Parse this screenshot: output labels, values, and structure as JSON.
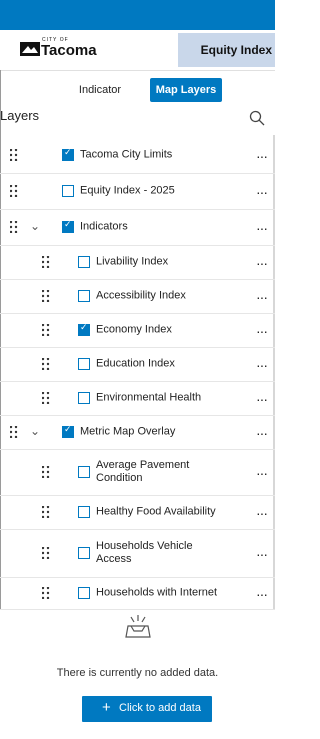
{
  "header": {
    "logo_small": "CITY OF",
    "logo_name": "Tacoma",
    "title": "Equity Index"
  },
  "tabs": [
    {
      "label": "Indicator",
      "active": false
    },
    {
      "label": "Map Layers",
      "active": true
    }
  ],
  "layers_title": "Layers",
  "layers": [
    {
      "label": "Tacoma City Limits",
      "checked": true,
      "level": 0,
      "expandable": false
    },
    {
      "label": "Equity Index - 2025",
      "checked": false,
      "level": 0,
      "expandable": false
    },
    {
      "label": "Indicators",
      "checked": true,
      "level": 0,
      "expandable": true,
      "expanded": true
    },
    {
      "label": "Livability Index",
      "checked": false,
      "level": 1
    },
    {
      "label": "Accessibility Index",
      "checked": false,
      "level": 1
    },
    {
      "label": "Economy Index",
      "checked": true,
      "level": 1
    },
    {
      "label": "Education Index",
      "checked": false,
      "level": 1
    },
    {
      "label": "Environmental Health",
      "checked": false,
      "level": 1
    },
    {
      "label": "Metric Map Overlay",
      "checked": true,
      "level": 0,
      "expandable": true,
      "expanded": true
    },
    {
      "label": "Average Pavement Condition",
      "checked": false,
      "level": 1
    },
    {
      "label": "Healthy Food Availability",
      "checked": false,
      "level": 1
    },
    {
      "label": "Households Vehicle Access",
      "checked": false,
      "level": 1
    },
    {
      "label": "Households with Internet",
      "checked": false,
      "level": 1
    }
  ],
  "empty_state": {
    "message": "There is currently no added data.",
    "button_label": "Click to add data"
  },
  "colors": {
    "accent": "#0079c1",
    "equity_tab": "#c9d7ea"
  }
}
